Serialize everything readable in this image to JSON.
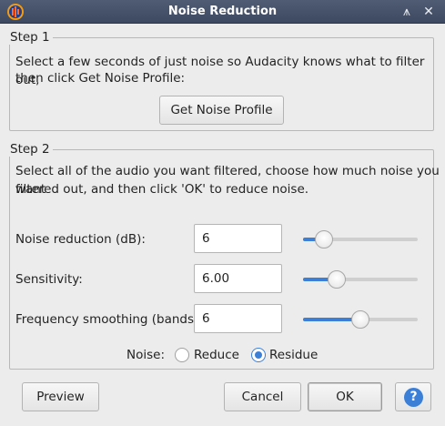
{
  "window": {
    "title": "Noise Reduction",
    "title_buttons": {
      "restore": "⩚",
      "close": "✕"
    }
  },
  "step1": {
    "legend": "Step 1",
    "description_line1": "Select a few seconds of just noise so Audacity knows what to filter out,",
    "description_line2": "then click Get Noise Profile:",
    "get_profile_label": "Get Noise Profile"
  },
  "step2": {
    "legend": "Step 2",
    "description_line1": "Select all of the audio you want filtered, choose how much noise you want",
    "description_line2": "filtered out, and then click 'OK' to reduce noise.",
    "controls": [
      {
        "label": "Noise reduction (dB):",
        "value": "6",
        "slider_fraction": 0.12
      },
      {
        "label": "Sensitivity:",
        "value": "6.00",
        "slider_fraction": 0.25
      },
      {
        "label": "Frequency smoothing (bands):",
        "value": "6",
        "slider_fraction": 0.5
      }
    ],
    "noise_label": "Noise:",
    "noise_options": [
      {
        "label": "Reduce",
        "checked": false
      },
      {
        "label": "Residue",
        "checked": true
      }
    ]
  },
  "buttons": {
    "preview": "Preview",
    "cancel": "Cancel",
    "ok": "OK",
    "help": "?"
  },
  "colors": {
    "accent": "#3c7fd6",
    "titlebar": "#45516a"
  },
  "icons": {
    "app": "audacity-logo-icon",
    "help": "help-icon"
  }
}
